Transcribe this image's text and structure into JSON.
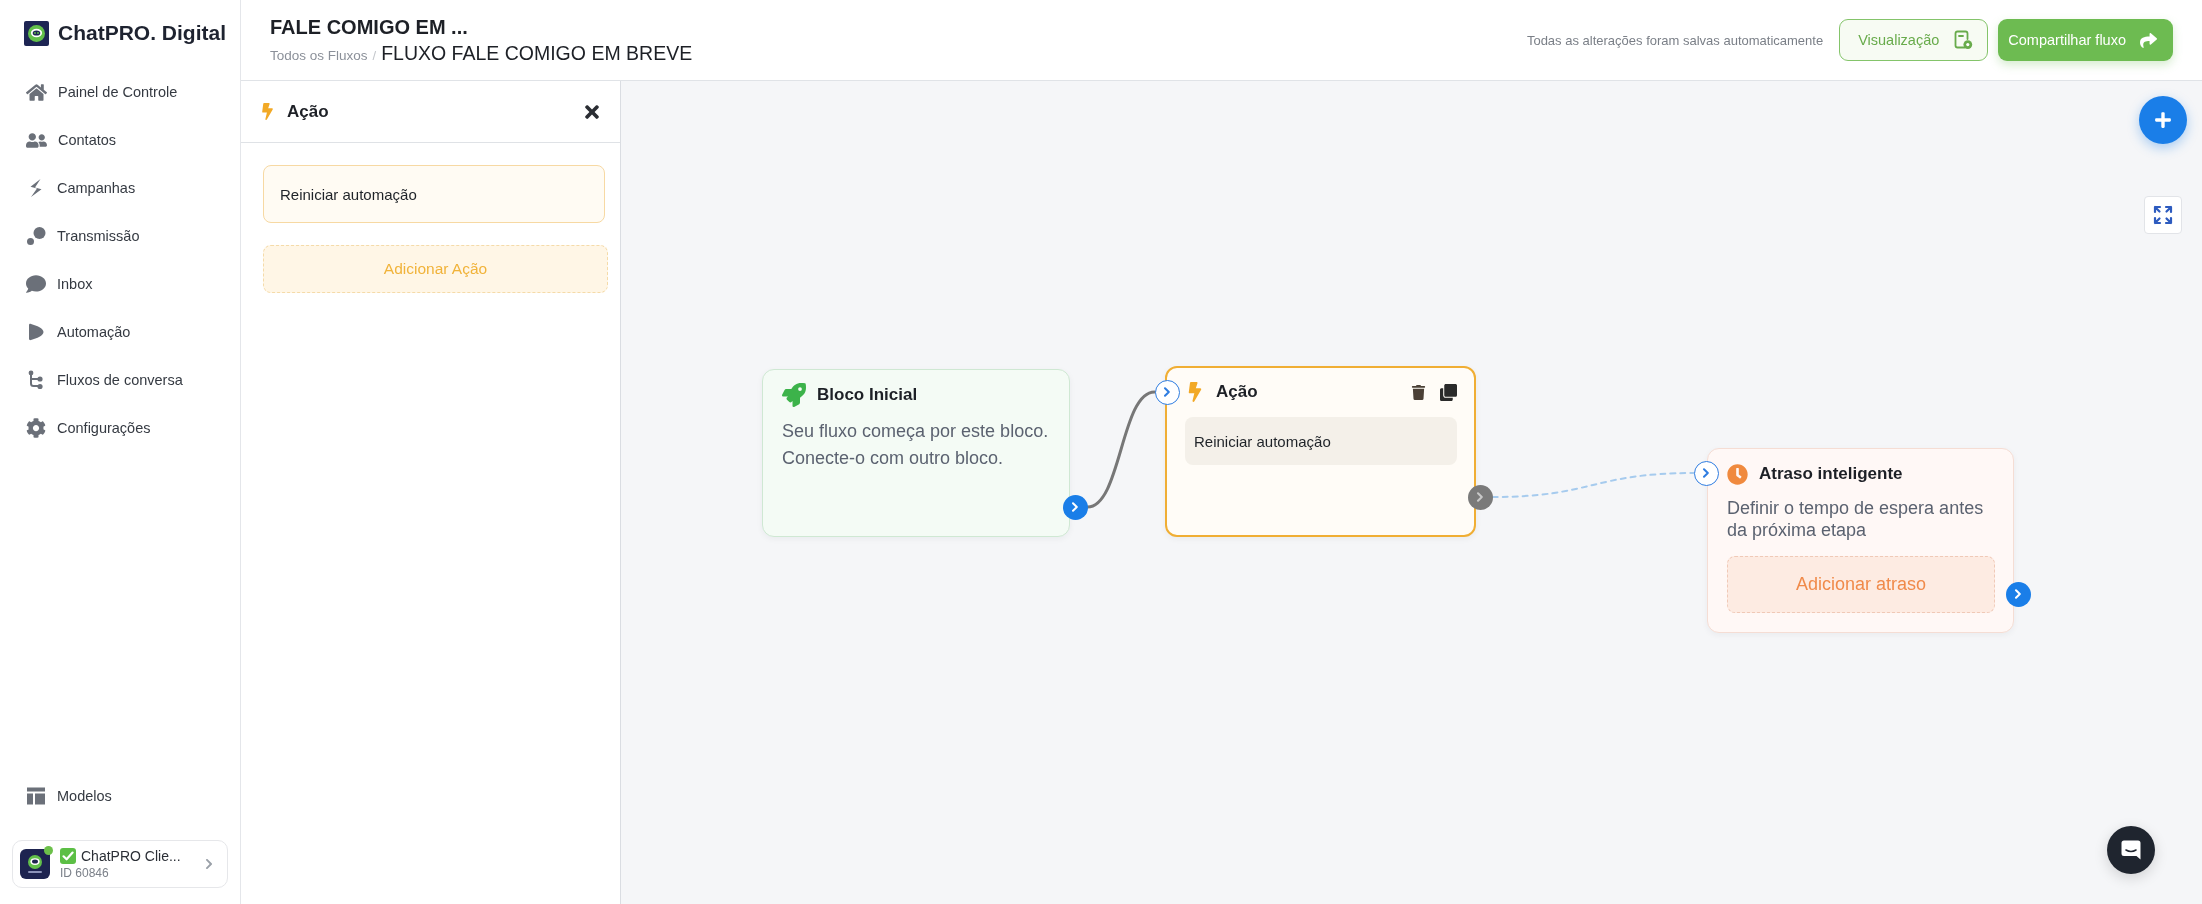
{
  "sidebar": {
    "brand": "ChatPRO. Digital",
    "items": [
      {
        "label": "Painel de Controle",
        "selected": false
      },
      {
        "label": "Contatos",
        "selected": false
      },
      {
        "label": "Campanhas",
        "selected": false
      },
      {
        "label": "Transmissão",
        "selected": false
      },
      {
        "label": "Inbox",
        "selected": false
      },
      {
        "label": "Automação",
        "selected": false
      },
      {
        "label": "Fluxos de conversa",
        "selected": false
      },
      {
        "label": "Configurações",
        "selected": false
      }
    ],
    "footer_items": [
      {
        "label": "Modelos",
        "selected": false
      }
    ],
    "account": {
      "name": "ChatPRO Clie...",
      "id": "ID 60846",
      "online": true
    }
  },
  "header": {
    "title": "FALE COMIGO EM ...",
    "breadcrumb": {
      "parent": "Todos os Fluxos",
      "separator": "/",
      "current": "FLUXO FALE COMIGO EM BREVE"
    },
    "save_status": "Todas as alterações foram salvas automaticamente",
    "buttons": [
      {
        "label": "Visualização",
        "kind": "outline"
      },
      {
        "label": "Compartilhar fluxo",
        "kind": "primary"
      }
    ]
  },
  "panel": {
    "title": "Ação",
    "actions": [
      "Reiniciar automação"
    ],
    "add_button": "Adicionar Ação"
  },
  "canvas": {
    "nodes": [
      {
        "kind": "start",
        "title": "Bloco Inicial",
        "description": "Seu fluxo começa por este bloco. Conecte-o com outro bloco.",
        "selected": false
      },
      {
        "kind": "action",
        "title": "Ação",
        "items": [
          "Reiniciar automação"
        ],
        "selected": true
      },
      {
        "kind": "delay",
        "title": "Atraso inteligente",
        "description": "Definir o tempo de espera antes da próxima etapa",
        "add_button": "Adicionar atraso",
        "selected": false
      }
    ],
    "edges": [
      {
        "kind": "solid"
      },
      {
        "kind": "dashed"
      }
    ]
  }
}
